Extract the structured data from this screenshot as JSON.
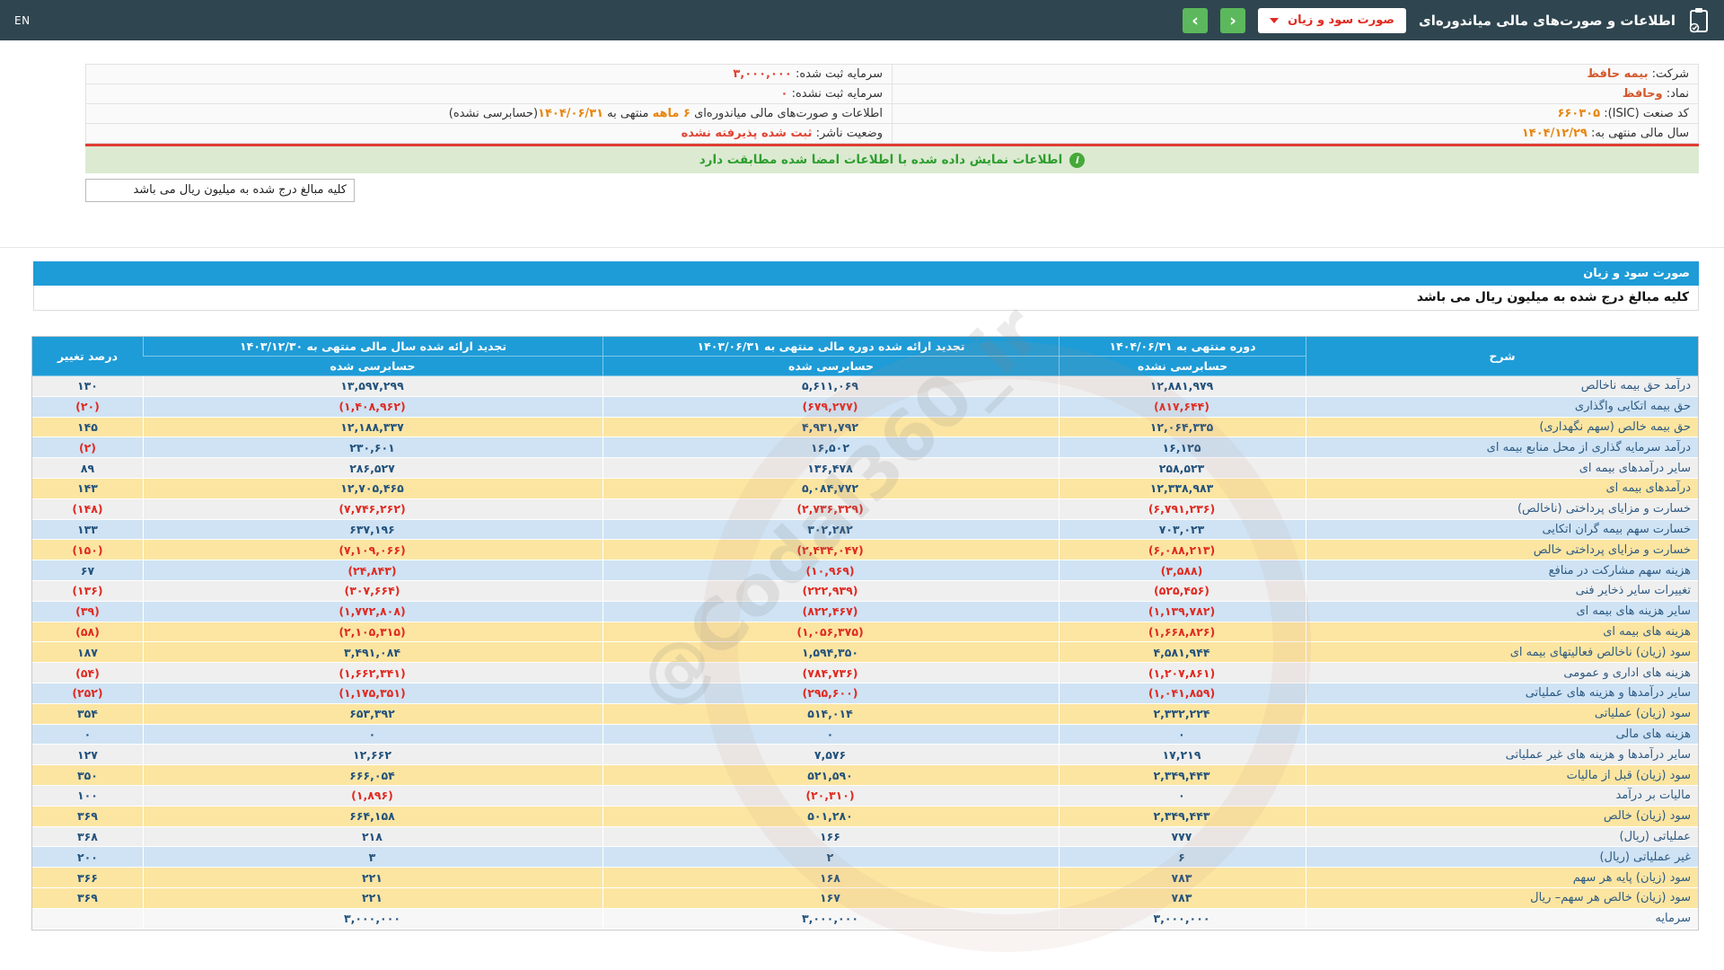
{
  "topbar": {
    "en_label": "EN",
    "title": "اطلاعات و صورت‌های مالی میاندوره‌ای",
    "dropdown_value": "صورت سود و زیان",
    "nav_prev_glyph": "‹",
    "nav_next_glyph": "›"
  },
  "company_info": {
    "company_label": "شرکت:",
    "company_value": "بیمه حافظ",
    "symbol_label": "نماد:",
    "symbol_value": "وحافظ",
    "isic_label": "کد صنعت (ISIC):",
    "isic_value": "۶۶۰۳۰۵",
    "fiscal_year_label": "سال مالی منتهی به:",
    "fiscal_year_value": "۱۴۰۴/۱۲/۲۹",
    "registered_capital_label": "سرمایه ثبت شده:",
    "registered_capital_value": "۳,۰۰۰,۰۰۰",
    "unregistered_capital_label": "سرمایه ثبت نشده:",
    "unregistered_capital_value": "۰",
    "period_prefix": "اطلاعات و صورت‌های مالی میاندوره‌ای",
    "period_months": "۶ ماهه",
    "period_connector": "منتهی به",
    "period_date": "۱۴۰۴/۰۶/۳۱",
    "period_suffix": "(حسابرسی نشده)",
    "publisher_status_label": "وضعیت ناشر:",
    "publisher_status_value": "ثبت شده پذیرفته نشده",
    "info_icon_glyph": "i"
  },
  "alert_text": "اطلاعات نمایش داده شده با اطلاعات امضا شده مطابقت دارد",
  "units_note": "کلیه مبالغ درج شده به میلیون ریال می باشد",
  "statement": {
    "title": "صورت سود و زیان",
    "units_note": "کلیه مبالغ درج شده به میلیون ریال می باشد"
  },
  "watermark": "@Codal360_ir",
  "colors": {
    "topbar_bg": "#2f4650",
    "accent_blue": "#1e9cd7",
    "nav_green": "#5cb85c",
    "row_yellow": "#fce5a1",
    "row_blue": "#cfe3f4",
    "row_gray": "#efefef",
    "positive_value": "#23527c",
    "negative_value": "#e02a21",
    "alert_bg": "#dcead2",
    "alert_text": "#2e9e2e",
    "red_separator": "#df3e33"
  },
  "table": {
    "headers": {
      "description": "شرح",
      "col1_line1": "دوره منتهی به ۱۴۰۴/۰۶/۳۱",
      "col1_line2": "حسابرسی نشده",
      "col2_line1": "تجدید ارائه شده دوره مالی منتهی به ۱۴۰۳/۰۶/۳۱",
      "col2_line2": "حسابرسی شده",
      "col3_line1": "تجدید ارائه شده سال مالی منتهی به ۱۴۰۳/۱۲/۳۰",
      "col3_line2": "حسابرسی شده",
      "change": "درصد تغییر"
    },
    "rows": [
      {
        "label": "درآمد حق بیمه ناخالص",
        "v1": "۱۲,۸۸۱,۹۷۹",
        "v2": "۵,۶۱۱,۰۶۹",
        "v3": "۱۳,۵۹۷,۲۹۹",
        "change": "۱۳۰",
        "bg": "gray"
      },
      {
        "label": "حق بیمه اتکایی واگذاری",
        "v1": "(۸۱۷,۶۴۴)",
        "v2": "(۶۷۹,۲۷۷)",
        "v3": "(۱,۴۰۸,۹۶۲)",
        "change": "(۲۰)",
        "bg": "blue"
      },
      {
        "label": "حق بیمه خالص (سهم نگهداری)",
        "v1": "۱۲,۰۶۴,۳۳۵",
        "v2": "۴,۹۳۱,۷۹۲",
        "v3": "۱۲,۱۸۸,۳۳۷",
        "change": "۱۴۵",
        "bg": "yellow"
      },
      {
        "label": "درآمد سرمایه گذاری از محل منابع بیمه ای",
        "v1": "۱۶,۱۲۵",
        "v2": "۱۶,۵۰۲",
        "v3": "۲۳۰,۶۰۱",
        "change": "(۲)",
        "bg": "blue"
      },
      {
        "label": "سایر درآمدهای بیمه ای",
        "v1": "۲۵۸,۵۲۳",
        "v2": "۱۳۶,۴۷۸",
        "v3": "۲۸۶,۵۲۷",
        "change": "۸۹",
        "bg": "gray"
      },
      {
        "label": "درآمدهای بیمه ای",
        "v1": "۱۲,۳۳۸,۹۸۳",
        "v2": "۵,۰۸۴,۷۷۲",
        "v3": "۱۲,۷۰۵,۴۶۵",
        "change": "۱۴۳",
        "bg": "yellow"
      },
      {
        "label": "خسارت و مزایای پرداختی (ناخالص)",
        "v1": "(۶,۷۹۱,۲۳۶)",
        "v2": "(۲,۷۳۶,۳۲۹)",
        "v3": "(۷,۷۴۶,۲۶۲)",
        "change": "(۱۴۸)",
        "bg": "gray"
      },
      {
        "label": "خسارت سهم بیمه گران اتکایی",
        "v1": "۷۰۳,۰۲۳",
        "v2": "۳۰۲,۲۸۲",
        "v3": "۶۳۷,۱۹۶",
        "change": "۱۳۳",
        "bg": "blue"
      },
      {
        "label": "خسارت و مزایای پرداختی خالص",
        "v1": "(۶,۰۸۸,۲۱۳)",
        "v2": "(۲,۴۳۴,۰۴۷)",
        "v3": "(۷,۱۰۹,۰۶۶)",
        "change": "(۱۵۰)",
        "bg": "yellow"
      },
      {
        "label": "هزینه سهم مشارکت در منافع",
        "v1": "(۳,۵۸۸)",
        "v2": "(۱۰,۹۶۹)",
        "v3": "(۲۴,۸۴۳)",
        "change": "۶۷",
        "bg": "blue"
      },
      {
        "label": "تغییرات سایر ذخایر فنی",
        "v1": "(۵۲۵,۴۵۶)",
        "v2": "(۲۲۲,۹۳۹)",
        "v3": "(۳۰۷,۶۶۴)",
        "change": "(۱۳۶)",
        "bg": "gray"
      },
      {
        "label": "سایر هزینه های بیمه ای",
        "v1": "(۱,۱۳۹,۷۸۲)",
        "v2": "(۸۲۲,۴۶۷)",
        "v3": "(۱,۷۷۲,۸۰۸)",
        "change": "(۳۹)",
        "bg": "blue"
      },
      {
        "label": "هزینه های بیمه ای",
        "v1": "(۱,۶۶۸,۸۲۶)",
        "v2": "(۱,۰۵۶,۳۷۵)",
        "v3": "(۲,۱۰۵,۳۱۵)",
        "change": "(۵۸)",
        "bg": "yellow"
      },
      {
        "label": "سود (زیان) ناخالص فعالیتهای بیمه ای",
        "v1": "۴,۵۸۱,۹۴۴",
        "v2": "۱,۵۹۴,۳۵۰",
        "v3": "۳,۴۹۱,۰۸۴",
        "change": "۱۸۷",
        "bg": "yellow"
      },
      {
        "label": "هزینه های اداری و عمومی",
        "v1": "(۱,۲۰۷,۸۶۱)",
        "v2": "(۷۸۴,۷۳۶)",
        "v3": "(۱,۶۶۲,۳۴۱)",
        "change": "(۵۴)",
        "bg": "gray"
      },
      {
        "label": "سایر درآمدها و هزینه های عملیاتی",
        "v1": "(۱,۰۴۱,۸۵۹)",
        "v2": "(۲۹۵,۶۰۰)",
        "v3": "(۱,۱۷۵,۳۵۱)",
        "change": "(۲۵۲)",
        "bg": "blue"
      },
      {
        "label": "سود (زیان) عملیاتی",
        "v1": "۲,۳۳۲,۲۲۴",
        "v2": "۵۱۴,۰۱۴",
        "v3": "۶۵۳,۳۹۲",
        "change": "۳۵۴",
        "bg": "yellow"
      },
      {
        "label": "هزینه های مالی",
        "v1": "۰",
        "v2": "۰",
        "v3": "۰",
        "change": "۰",
        "bg": "blue"
      },
      {
        "label": "سایر درآمدها و هزینه های غیر عملیاتی",
        "v1": "۱۷,۲۱۹",
        "v2": "۷,۵۷۶",
        "v3": "۱۲,۶۶۲",
        "change": "۱۲۷",
        "bg": "gray"
      },
      {
        "label": "سود (زیان) قبل از مالیات",
        "v1": "۲,۳۴۹,۴۴۳",
        "v2": "۵۲۱,۵۹۰",
        "v3": "۶۶۶,۰۵۴",
        "change": "۳۵۰",
        "bg": "yellow"
      },
      {
        "label": "مالیات بر درآمد",
        "v1": "۰",
        "v2": "(۲۰,۳۱۰)",
        "v3": "(۱,۸۹۶)",
        "change": "۱۰۰",
        "bg": "gray"
      },
      {
        "label": "سود (زیان) خالص",
        "v1": "۲,۳۴۹,۴۴۳",
        "v2": "۵۰۱,۲۸۰",
        "v3": "۶۶۴,۱۵۸",
        "change": "۳۶۹",
        "bg": "yellow"
      },
      {
        "label": "عملیاتی (ریال)",
        "v1": "۷۷۷",
        "v2": "۱۶۶",
        "v3": "۲۱۸",
        "change": "۳۶۸",
        "bg": "gray"
      },
      {
        "label": "غیر عملیاتی (ریال)",
        "v1": "۶",
        "v2": "۲",
        "v3": "۳",
        "change": "۲۰۰",
        "bg": "blue"
      },
      {
        "label": "سود (زیان) پایه هر سهم",
        "v1": "۷۸۳",
        "v2": "۱۶۸",
        "v3": "۲۲۱",
        "change": "۳۶۶",
        "bg": "yellow"
      },
      {
        "label": "سود (زیان) خالص هر سهم– ریال",
        "v1": "۷۸۳",
        "v2": "۱۶۷",
        "v3": "۲۲۱",
        "change": "۳۶۹",
        "bg": "yellow"
      },
      {
        "label": "سرمایه",
        "v1": "۳,۰۰۰,۰۰۰",
        "v2": "۳,۰۰۰,۰۰۰",
        "v3": "۳,۰۰۰,۰۰۰",
        "change": "",
        "bg": "white"
      }
    ]
  }
}
